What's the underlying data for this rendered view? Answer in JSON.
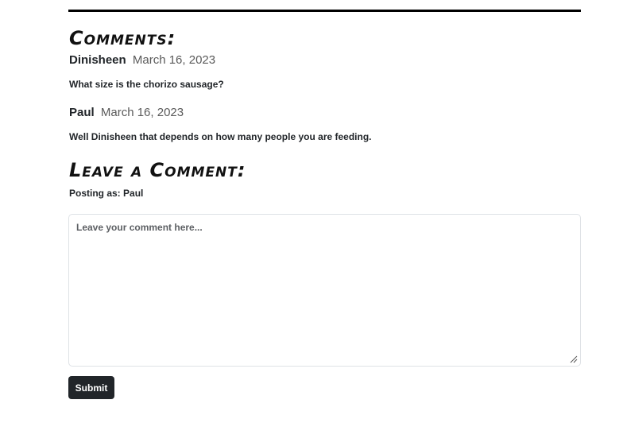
{
  "comments_section": {
    "heading": "Comments:",
    "comments": [
      {
        "author": "Dinisheen",
        "date": "March 16, 2023",
        "body": "What size is the chorizo sausage?"
      },
      {
        "author": "Paul",
        "date": "March 16, 2023",
        "body": "Well Dinisheen that depends on how many people you are feeding."
      }
    ]
  },
  "leave_comment": {
    "heading": "Leave a Comment:",
    "posting_as": "Posting as: Paul",
    "textarea_placeholder": "Leave your comment here...",
    "submit_label": "Submit"
  },
  "colors": {
    "rule": "#000000",
    "text": "#212529",
    "date": "#5a5a5a",
    "button_bg": "#212529",
    "button_text": "#ffffff",
    "border": "#dee2e6"
  },
  "icons": {
    "resize": "resize-handle-icon"
  }
}
